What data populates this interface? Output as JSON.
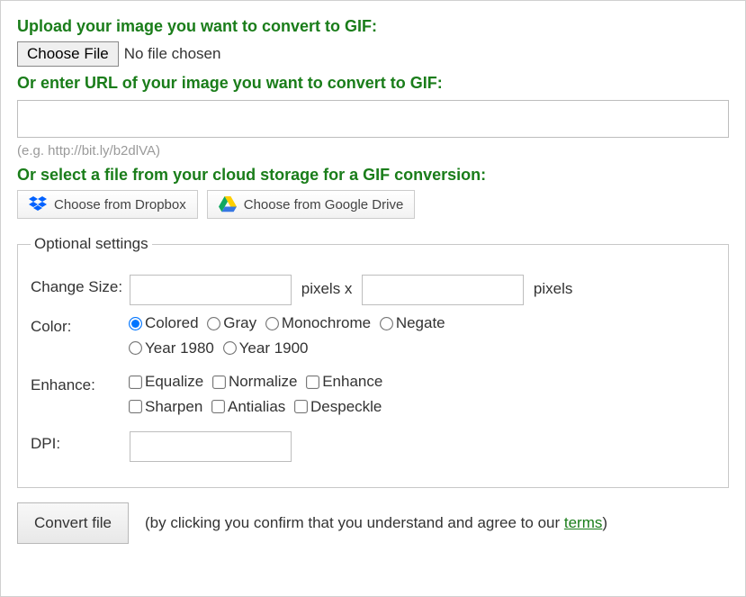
{
  "upload": {
    "heading": "Upload your image you want to convert to GIF:",
    "choose_button": "Choose File",
    "status": "No file chosen"
  },
  "url": {
    "heading": "Or enter URL of your image you want to convert to GIF:",
    "value": "",
    "hint": "(e.g. http://bit.ly/b2dlVA)"
  },
  "cloud": {
    "heading": "Or select a file from your cloud storage for a GIF conversion:",
    "dropbox_label": "Choose from Dropbox",
    "gdrive_label": "Choose from Google Drive"
  },
  "optional": {
    "legend": "Optional settings",
    "size": {
      "label": "Change Size:",
      "mid": "pixels x",
      "suffix": "pixels"
    },
    "color": {
      "label": "Color:",
      "options": [
        "Colored",
        "Gray",
        "Monochrome",
        "Negate",
        "Year 1980",
        "Year 1900"
      ],
      "selected": 0
    },
    "enhance": {
      "label": "Enhance:",
      "options": [
        "Equalize",
        "Normalize",
        "Enhance",
        "Sharpen",
        "Antialias",
        "Despeckle"
      ]
    },
    "dpi": {
      "label": "DPI:"
    }
  },
  "submit": {
    "button": "Convert file",
    "disclaimer_pre": "(by clicking you confirm that you understand and agree to our ",
    "terms": "terms",
    "disclaimer_post": ")"
  }
}
